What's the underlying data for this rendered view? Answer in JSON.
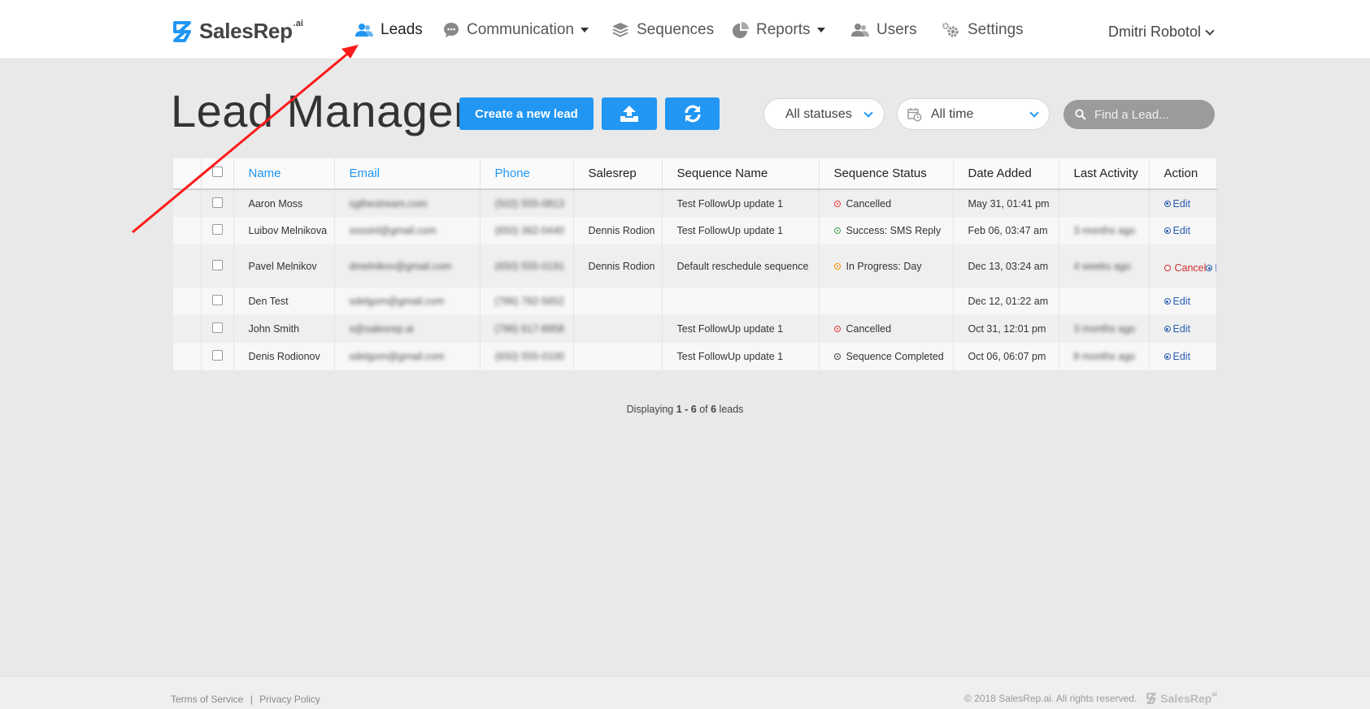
{
  "brand": {
    "name": "SalesRep",
    "suffix": ".ai",
    "color": "#2196f3"
  },
  "nav": {
    "leads": "Leads",
    "communication": "Communication",
    "sequences": "Sequences",
    "reports": "Reports",
    "users": "Users",
    "settings": "Settings",
    "user_name": "Dmitri Robotol"
  },
  "toolbar": {
    "title": "Lead Manager",
    "create_label": "Create a new lead",
    "upload_icon": "upload-icon",
    "refresh_icon": "refresh-icon",
    "status_filter": "All statuses",
    "time_filter": "All time",
    "search_placeholder": "Find a Lead..."
  },
  "table": {
    "columns": [
      "Name",
      "Email",
      "Phone",
      "Salesrep",
      "Sequence Name",
      "Sequence Status",
      "Date Added",
      "Last Activity",
      "Action"
    ],
    "rows": [
      {
        "name": "Aaron Moss",
        "email": "sgthestream.com",
        "phone": "(502) 555-0813",
        "salesrep": "",
        "sequence": "Test FollowUp update 1",
        "status": "Cancelled",
        "status_color": "red",
        "date": "May 31, 01:41 pm",
        "last_activity": "",
        "actions": [
          "Edit"
        ]
      },
      {
        "name": "Luibov Melnikova",
        "email": "ssssinl@gmail.com",
        "phone": "(650) 362-0440",
        "salesrep": "Dennis Rodion",
        "sequence": "Test FollowUp update 1",
        "status": "Success: SMS Reply",
        "status_color": "green",
        "date": "Feb 06, 03:47 am",
        "last_activity": "3 months ago",
        "actions": [
          "Edit"
        ]
      },
      {
        "name": "Pavel Melnikov",
        "email": "dmelnikov@gmail.com",
        "phone": "(650) 555-0191",
        "salesrep": "Dennis Rodion",
        "sequence": "Default reschedule sequence",
        "status": "In Progress: Day",
        "status_color": "orange",
        "date": "Dec 13, 03:24 am",
        "last_activity": "4 weeks ago",
        "actions": [
          "Cancel",
          "Edit"
        ]
      },
      {
        "name": "Den Test",
        "email": "sdelgom@gmail.com",
        "phone": "(786) 782-5652",
        "salesrep": "",
        "sequence": "",
        "status": "",
        "status_color": "",
        "date": "Dec 12, 01:22 am",
        "last_activity": "",
        "actions": [
          "Edit"
        ]
      },
      {
        "name": "John Smith",
        "email": "s@salesrep.ai",
        "phone": "(786) 617-8958",
        "salesrep": "",
        "sequence": "Test FollowUp update 1",
        "status": "Cancelled",
        "status_color": "red",
        "date": "Oct 31, 12:01 pm",
        "last_activity": "3 months ago",
        "actions": [
          "Edit"
        ]
      },
      {
        "name": "Denis Rodionov",
        "email": "sdelgom@gmail.com",
        "phone": "(650) 555-0100",
        "salesrep": "",
        "sequence": "Test FollowUp update 1",
        "status": "Sequence Completed",
        "status_color": "dark",
        "date": "Oct 06, 06:07 pm",
        "last_activity": "8 months ago",
        "actions": [
          "Edit"
        ]
      }
    ]
  },
  "summary": {
    "prefix": "Displaying ",
    "range": "1 - 6",
    "middle": " of ",
    "total": "6",
    "suffix": " leads"
  },
  "footer": {
    "terms": "Terms of Service",
    "separator": "|",
    "privacy": "Privacy Policy",
    "copyright": "© 2018 SalesRep.ai. All rights reserved.",
    "logo_text": "SalesRep",
    "logo_sup": "ai"
  },
  "colors": {
    "accent": "#2196f3",
    "annotation": "#ff1a1a",
    "cancel": "#d32f2f"
  }
}
